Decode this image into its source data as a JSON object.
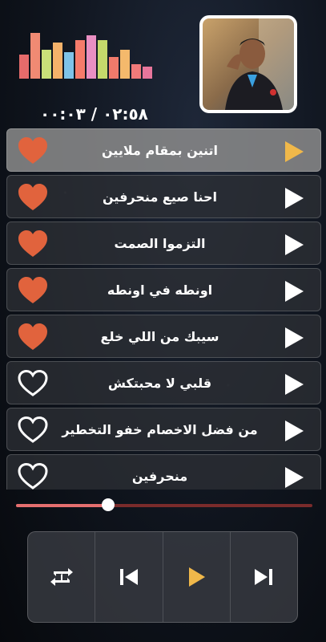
{
  "player": {
    "time_display": "٠٢:٥٨ / ٠٠:٠٣",
    "progress_fraction": 0.31
  },
  "colors": {
    "accent": "#e1633d",
    "play_active": "#f0b84a",
    "seek_fill": "#e56f6f"
  },
  "equalizer": {
    "levels": [
      0.5,
      0.95,
      0.6,
      0.75,
      0.55,
      0.8,
      0.9,
      0.8,
      0.45,
      0.6,
      0.3,
      0.25
    ],
    "colors": [
      "#e66b6b",
      "#f08a73",
      "#c9e079",
      "#f5b26a",
      "#7fc3e8",
      "#f57b6b",
      "#e98fc3",
      "#c5d96b",
      "#f07a6b",
      "#f4b96c",
      "#f07a7a",
      "#e8769b"
    ]
  },
  "tracks": [
    {
      "title": "اتنين بمقام ملايين",
      "liked": true,
      "active": true
    },
    {
      "title": "احنا صيع منحرفين",
      "liked": true,
      "active": false
    },
    {
      "title": "التزموا الصمت",
      "liked": true,
      "active": false
    },
    {
      "title": "اونطه في اونطه",
      "liked": true,
      "active": false
    },
    {
      "title": "سيبك من اللي خلع",
      "liked": true,
      "active": false
    },
    {
      "title": "قلبي لا محبتكش",
      "liked": false,
      "active": false
    },
    {
      "title": "من فضل الاخصام خفو التخطير",
      "liked": false,
      "active": false
    },
    {
      "title": "منحرفين",
      "liked": false,
      "active": false
    }
  ],
  "controls": {
    "icons": [
      "repeat-one-icon",
      "previous-icon",
      "play-icon",
      "next-icon"
    ]
  }
}
